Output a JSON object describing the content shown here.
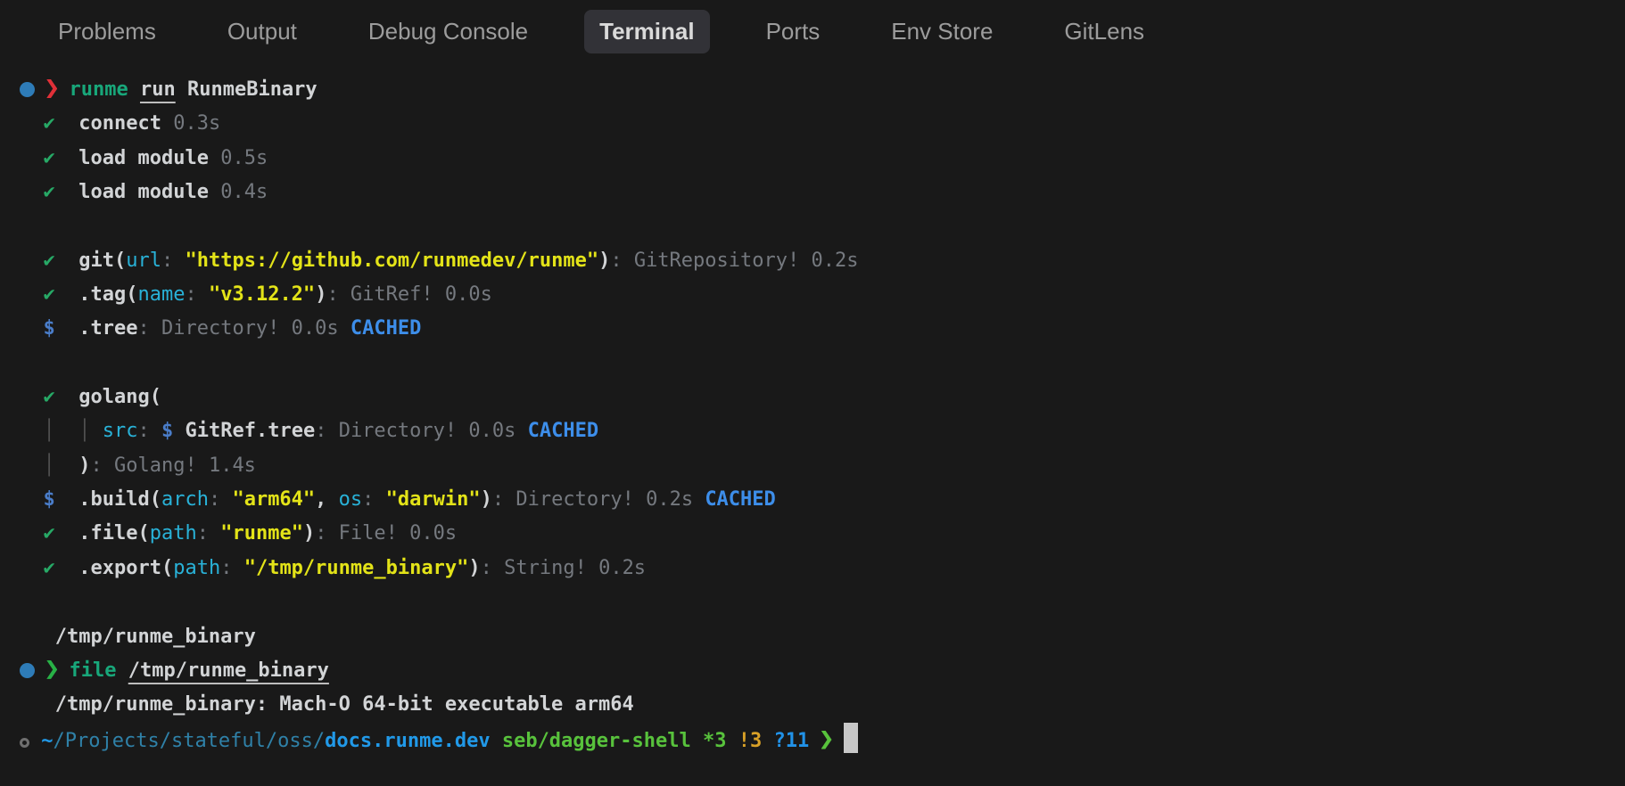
{
  "palette": {
    "bg": "#191919",
    "tabInactive": "#9c9c9c",
    "tabActiveBg": "#323237",
    "tabActiveFg": "#dadada",
    "fg": "#d2d4d6",
    "gray": "#75797f",
    "check": "#27a966",
    "cmd": "#18a77a",
    "red": "#e03038",
    "cyan": "#29b2d8",
    "yellow": "#e3e318",
    "dollar": "#4a7dc9",
    "cached": "#3d8eea",
    "guide": "#505050",
    "pathdim": "#2f81a8",
    "pathbright": "#2199e8",
    "lime": "#58c23c",
    "gold": "#d9a127",
    "qblue": "#2192e8",
    "green2": "#28b146",
    "cursorC": "#c8c8c8",
    "odot": "#6f6f6f",
    "dot": "#2e7cb8"
  },
  "tabs": {
    "items": [
      {
        "label": "Problems",
        "active": false
      },
      {
        "label": "Output",
        "active": false
      },
      {
        "label": "Debug Console",
        "active": false
      },
      {
        "label": "Terminal",
        "active": true
      },
      {
        "label": "Ports",
        "active": false
      },
      {
        "label": "Env Store",
        "active": false
      },
      {
        "label": "GitLens",
        "active": false
      }
    ]
  },
  "terminal": {
    "lines": [
      {
        "segments": [
          {
            "shape": "dot",
            "n": "prompt-active-dot"
          },
          {
            "t": " "
          },
          {
            "shape": "chev",
            "s": "red",
            "n": "prompt-chevron-icon"
          },
          {
            "t": " "
          },
          {
            "t": "runme",
            "s": "cmd"
          },
          {
            "t": " ",
            "s": "fg"
          },
          {
            "t": "run",
            "s": "fgu"
          },
          {
            "t": " RunmeBinary",
            "s": "fg"
          }
        ]
      },
      {
        "segments": [
          {
            "t": "  "
          },
          {
            "t": "✔",
            "s": "check",
            "n": "check-icon"
          },
          {
            "t": "  "
          },
          {
            "t": "connect ",
            "s": "fg"
          },
          {
            "t": "0.3s",
            "s": "gray"
          }
        ]
      },
      {
        "segments": [
          {
            "t": "  "
          },
          {
            "t": "✔",
            "s": "check",
            "n": "check-icon"
          },
          {
            "t": "  "
          },
          {
            "t": "load module ",
            "s": "fg"
          },
          {
            "t": "0.5s",
            "s": "gray"
          }
        ]
      },
      {
        "segments": [
          {
            "t": "  "
          },
          {
            "t": "✔",
            "s": "check",
            "n": "check-icon"
          },
          {
            "t": "  "
          },
          {
            "t": "load module ",
            "s": "fg"
          },
          {
            "t": "0.4s",
            "s": "gray"
          }
        ]
      },
      {
        "segments": []
      },
      {
        "segments": [
          {
            "t": "  "
          },
          {
            "t": "✔",
            "s": "check",
            "n": "check-icon"
          },
          {
            "t": "  "
          },
          {
            "t": "git(",
            "s": "fg"
          },
          {
            "t": "url",
            "s": "cyan"
          },
          {
            "t": ": ",
            "s": "gray"
          },
          {
            "t": "\"https://github.com/runmedev/runme\"",
            "s": "yellow"
          },
          {
            "t": ")",
            "s": "fg"
          },
          {
            "t": ": GitRepository! 0.2s",
            "s": "gray"
          }
        ]
      },
      {
        "segments": [
          {
            "t": "  "
          },
          {
            "t": "✔",
            "s": "check",
            "n": "check-icon"
          },
          {
            "t": "  "
          },
          {
            "t": ".tag(",
            "s": "fg"
          },
          {
            "t": "name",
            "s": "cyan"
          },
          {
            "t": ": ",
            "s": "gray"
          },
          {
            "t": "\"v3.12.2\"",
            "s": "yellow"
          },
          {
            "t": ")",
            "s": "fg"
          },
          {
            "t": ": GitRef! 0.0s",
            "s": "gray"
          }
        ]
      },
      {
        "segments": [
          {
            "t": "  "
          },
          {
            "t": "$",
            "s": "dollar",
            "n": "pipe-dollar-icon"
          },
          {
            "t": "  "
          },
          {
            "t": ".tree",
            "s": "fg"
          },
          {
            "t": ": Directory! 0.0s ",
            "s": "gray"
          },
          {
            "t": "CACHED",
            "s": "cached",
            "n": "cached-badge"
          }
        ]
      },
      {
        "segments": []
      },
      {
        "segments": [
          {
            "t": "  "
          },
          {
            "t": "✔",
            "s": "check",
            "n": "check-icon"
          },
          {
            "t": "  "
          },
          {
            "t": "golang(",
            "s": "fg"
          }
        ]
      },
      {
        "segments": [
          {
            "t": "  "
          },
          {
            "t": "│",
            "s": "guide",
            "n": "indent-guide"
          },
          {
            "t": "  "
          },
          {
            "t": "│",
            "s": "guide",
            "n": "indent-guide"
          },
          {
            "t": " "
          },
          {
            "t": "src",
            "s": "cyan"
          },
          {
            "t": ": ",
            "s": "gray"
          },
          {
            "t": "$",
            "s": "dollar",
            "n": "pipe-dollar-icon"
          },
          {
            "t": " "
          },
          {
            "t": "GitRef.tree",
            "s": "fg"
          },
          {
            "t": ": Directory! 0.0s ",
            "s": "gray"
          },
          {
            "t": "CACHED",
            "s": "cached",
            "n": "cached-badge"
          }
        ]
      },
      {
        "segments": [
          {
            "t": "  "
          },
          {
            "t": "│",
            "s": "guide",
            "n": "indent-guide"
          },
          {
            "t": "  "
          },
          {
            "t": ")",
            "s": "fg"
          },
          {
            "t": ": Golang! 1.4s",
            "s": "gray"
          }
        ]
      },
      {
        "segments": [
          {
            "t": "  "
          },
          {
            "t": "$",
            "s": "dollar",
            "n": "pipe-dollar-icon"
          },
          {
            "t": "  "
          },
          {
            "t": ".build(",
            "s": "fg"
          },
          {
            "t": "arch",
            "s": "cyan"
          },
          {
            "t": ": ",
            "s": "gray"
          },
          {
            "t": "\"arm64\"",
            "s": "yellow"
          },
          {
            "t": ", ",
            "s": "fg"
          },
          {
            "t": "os",
            "s": "cyan"
          },
          {
            "t": ": ",
            "s": "gray"
          },
          {
            "t": "\"darwin\"",
            "s": "yellow"
          },
          {
            "t": ")",
            "s": "fg"
          },
          {
            "t": ": Directory! 0.2s ",
            "s": "gray"
          },
          {
            "t": "CACHED",
            "s": "cached",
            "n": "cached-badge"
          }
        ]
      },
      {
        "segments": [
          {
            "t": "  "
          },
          {
            "t": "✔",
            "s": "check",
            "n": "check-icon"
          },
          {
            "t": "  "
          },
          {
            "t": ".file(",
            "s": "fg"
          },
          {
            "t": "path",
            "s": "cyan"
          },
          {
            "t": ": ",
            "s": "gray"
          },
          {
            "t": "\"runme\"",
            "s": "yellow"
          },
          {
            "t": ")",
            "s": "fg"
          },
          {
            "t": ": File! 0.0s",
            "s": "gray"
          }
        ]
      },
      {
        "segments": [
          {
            "t": "  "
          },
          {
            "t": "✔",
            "s": "check",
            "n": "check-icon"
          },
          {
            "t": "  "
          },
          {
            "t": ".export(",
            "s": "fg"
          },
          {
            "t": "path",
            "s": "cyan"
          },
          {
            "t": ": ",
            "s": "gray"
          },
          {
            "t": "\"/tmp/runme_binary\"",
            "s": "yellow"
          },
          {
            "t": ")",
            "s": "fg"
          },
          {
            "t": ": String! 0.2s",
            "s": "gray"
          }
        ]
      },
      {
        "segments": []
      },
      {
        "segments": [
          {
            "t": "   /tmp/runme_binary",
            "s": "fg"
          }
        ]
      },
      {
        "segments": [
          {
            "shape": "dot",
            "n": "prompt-active-dot"
          },
          {
            "t": " "
          },
          {
            "shape": "chev",
            "s": "green2",
            "n": "prompt-chevron-icon"
          },
          {
            "t": " "
          },
          {
            "t": "file",
            "s": "cmd"
          },
          {
            "t": " ",
            "s": "fg"
          },
          {
            "t": "/tmp/runme_binary",
            "s": "fgu"
          }
        ]
      },
      {
        "segments": [
          {
            "t": "   /tmp/runme_binary: Mach-O 64-bit executable arm64",
            "s": "fg"
          }
        ]
      },
      {
        "segments": [
          {
            "shape": "odot",
            "n": "prompt-pending-dot"
          },
          {
            "t": " "
          },
          {
            "t": "~",
            "s": "pathbright"
          },
          {
            "t": "/Projects/stateful/oss/",
            "s": "pathdim"
          },
          {
            "t": "docs.runme.dev",
            "s": "pathbright",
            "n": "cwd-basename"
          },
          {
            "t": " ",
            "s": "fg"
          },
          {
            "t": "seb/dagger-shell",
            "s": "lime",
            "n": "git-branch"
          },
          {
            "t": " ",
            "s": "fg"
          },
          {
            "t": "*3",
            "s": "lime",
            "n": "git-modified-count"
          },
          {
            "t": " ",
            "s": "fg"
          },
          {
            "t": "!3",
            "s": "gold",
            "n": "git-unstaged-count"
          },
          {
            "t": " ",
            "s": "fg"
          },
          {
            "t": "?11",
            "s": "qblue",
            "n": "git-untracked-count"
          },
          {
            "t": " ",
            "s": "fg"
          },
          {
            "shape": "chev",
            "s": "lime",
            "n": "prompt-chevron-icon"
          },
          {
            "t": " "
          },
          {
            "shape": "cursor",
            "n": "terminal-cursor"
          }
        ]
      }
    ]
  }
}
